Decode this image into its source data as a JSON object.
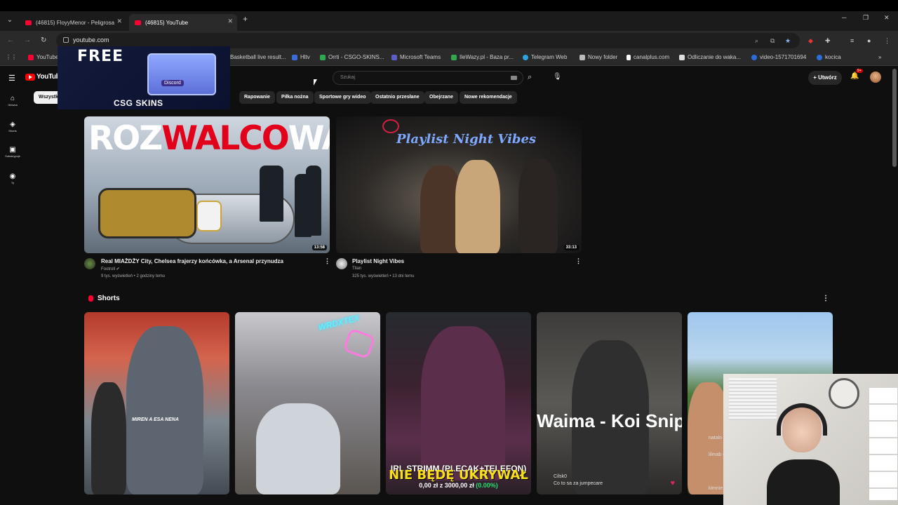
{
  "browser": {
    "tabs": [
      {
        "title": "(46815) FloyyMenor - Peligrosa"
      },
      {
        "title": "(46815) YouTube"
      }
    ],
    "url": "youtube.com",
    "bookmarks": [
      {
        "label": "YouTube"
      },
      {
        "label": "Basketball live result..."
      },
      {
        "label": "Hltv"
      },
      {
        "label": "Orrti - CSGO-SKINS..."
      },
      {
        "label": "Microsoft Teams"
      },
      {
        "label": "IleWazy.pl - Baza pr..."
      },
      {
        "label": "Telegram Web"
      },
      {
        "label": "Nowy folder"
      },
      {
        "label": "canalplus.com"
      },
      {
        "label": "Odliczanie do waka..."
      },
      {
        "label": "video-1571701694"
      },
      {
        "label": "kocica"
      }
    ]
  },
  "overlay": {
    "free": "FREE",
    "brand": "CSG SKINS",
    "box_label": "Discord"
  },
  "youtube": {
    "logo": "YouTube",
    "search_placeholder": "Szukaj",
    "create_label": "Utwórz",
    "notif_badge": "9+",
    "chips": [
      "Wszystk",
      "p",
      "Rapowanie",
      "Piłka nożna",
      "Sportowe gry wideo",
      "Ostatnio przesłane",
      "Obejrzane",
      "Nowe rekomendacje"
    ],
    "leftnav": [
      {
        "label": "Główna"
      },
      {
        "label": "Shorts"
      },
      {
        "label": "Subskrypcje"
      },
      {
        "label": "Ty"
      }
    ],
    "videos": [
      {
        "thumb_text_white1": "ROZ",
        "thumb_text_red": "WALCO",
        "thumb_text_white2": "WANI",
        "duration": "13:58",
        "title": "Real MIAŻDŻY City, Chelsea frajerzy końcówka, a Arsenal przynudza",
        "channel": "Footroll",
        "meta": "9 tys. wyświetleń • 2 godziny temu"
      },
      {
        "thumb_text": "Playlist Night Vibes",
        "duration": "33:13",
        "title": "Playlist Night Vibes",
        "channel": "Titan",
        "meta": "325 tys. wyświetleń • 13 dni temu"
      }
    ],
    "shorts_header": "Shorts",
    "shorts": [
      {
        "caption": "MIREN A ESA NENA"
      },
      {
        "neon": "WRDXTEX"
      },
      {
        "line1": "IRL STRIMM (PLECAK+TELEFON)",
        "line2": "NIE BĘDĘ UKRYWAŁ",
        "line3_amount": "0,00 zł z 3000,00 zł",
        "line3_pct": "(0.00%)"
      },
      {
        "caption": "Waima - Koi Snippet",
        "chat_user": "Cilsk0",
        "chat_text": "Co to sa za jumpecare"
      },
      {
        "chat": [
          "natalo Saludo",
          "lilmab que lo",
          "kimnie"
        ]
      }
    ]
  }
}
